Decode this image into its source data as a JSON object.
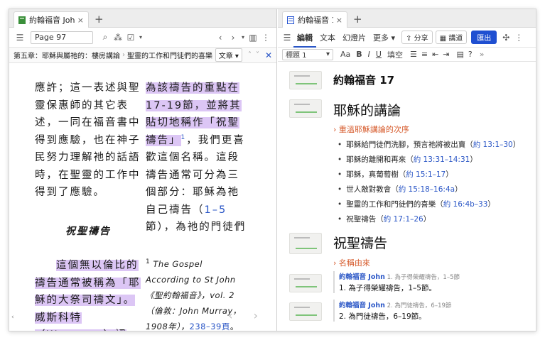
{
  "left": {
    "tab": {
      "label": "約翰福音 John",
      "close": "×",
      "plus": "+"
    },
    "toolbar": {
      "page": "Page 97"
    },
    "breadcrumb": {
      "chapter": "第五章：耶穌與屬祂的：樓房講論",
      "section": "聖靈的工作和門徒們的喜樂",
      "dropdown": "文章"
    },
    "text": {
      "col1_para": "應許；這一表述與聖靈保惠師的其它表述，一同在福音書中得到應驗，也在神子民努力理解祂的話語時，在聖靈的工作中得到了應驗。",
      "heading": "祝聖禱告",
      "col1_hl": "這個無以倫比的禱告通常被稱為「耶穌的大祭司禱文」。威斯科特（Westcott）認",
      "col2_hl1": "為該禱告的重點在",
      "col2_hl2": "17-19節，並將其貼切地稱作「祝聖禱告」",
      "col2_sup": "1",
      "col2_rest_a": "，我們更喜歡這個名稱。這段禱告通常可分為三個部分：耶穌為祂自己禱告（",
      "col2_ref": "1–5",
      "col2_rest_b": "節），為祂的門徒們",
      "footnote_num": "1",
      "footnote_a": " The Gospel According to St John《聖約翰福音》，vol. 2（倫敦：John Murray， 1908年），",
      "footnote_ref": "238–39頁",
      "footnote_end": "。"
    }
  },
  "right": {
    "tab": {
      "label": "約翰福音 17",
      "close": "×",
      "plus": "+"
    },
    "toolbar": {
      "edit": "編輯",
      "text": "文本",
      "slides": "幻燈片",
      "more": "更多",
      "share": "分享",
      "lecture": "講道",
      "present": "匯出"
    },
    "format": {
      "style": "標題 1",
      "font": "Aa",
      "bold": "B",
      "italic": "I",
      "underline": "U",
      "fill": "填空"
    },
    "doc": {
      "title": "約翰福音 17",
      "h1": "耶穌的講論",
      "sub1": "重溫耶穌講論的次序",
      "bullets": [
        {
          "text": "耶穌給門徒們洗腳，預言祂將被出賣",
          "ref": "約 13:1–30"
        },
        {
          "text": "耶穌的離開和再來",
          "ref": "約 13:31–14:31"
        },
        {
          "text": "耶穌，真葡萄樹",
          "ref": "約 15:1–17"
        },
        {
          "text": "世人敵對教會",
          "ref": "約 15:18–16:4a"
        },
        {
          "text": "聖靈的工作和門徒們的喜樂",
          "ref": "約 16:4b–33"
        },
        {
          "text": "祝聖禱告",
          "ref": "約 17:1–26"
        }
      ],
      "h2": "祝聖禱告",
      "sub2": "名稱由來",
      "cards": [
        {
          "src": "約翰福音 John",
          "meta": "1. 為子得榮耀禱告，1–5節",
          "text": "1. 為子得榮耀禱告，1–5節。"
        },
        {
          "src": "約翰福音 John",
          "meta": "2. 為門徒禱告，6–19節",
          "text": "2. 為門徒禱告，6–19節。"
        }
      ]
    }
  }
}
